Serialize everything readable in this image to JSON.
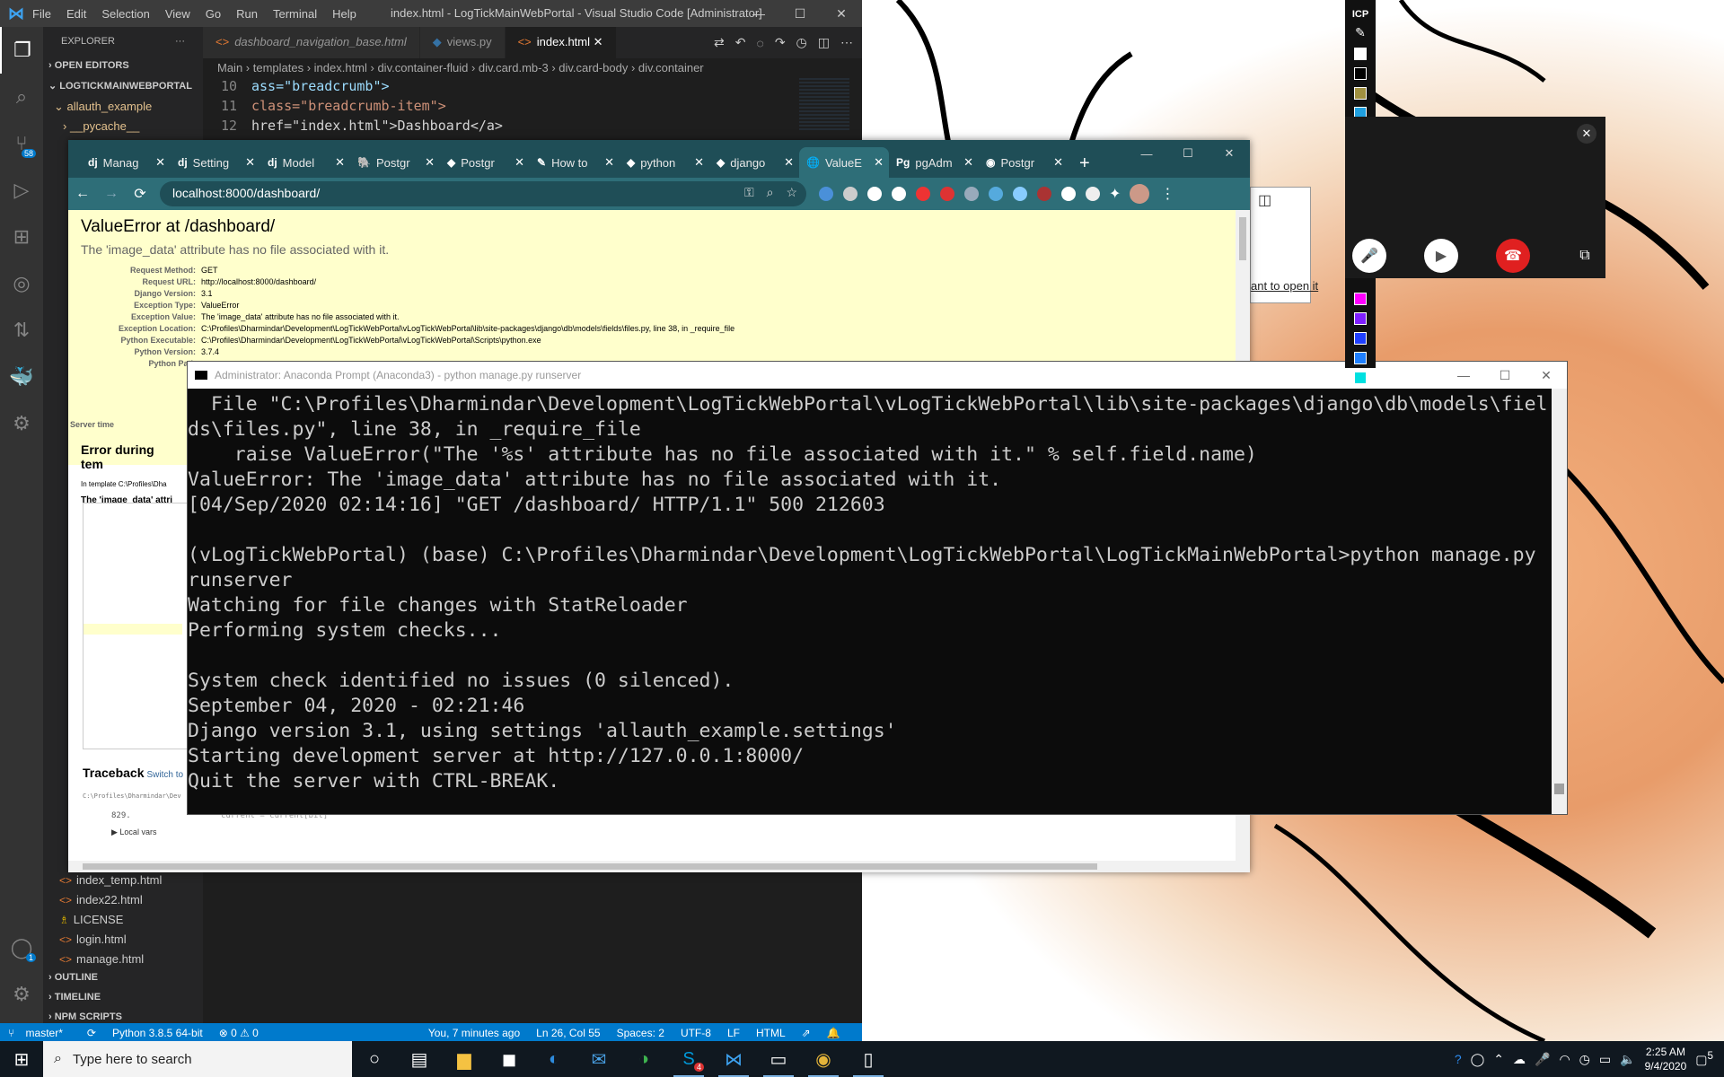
{
  "vscode": {
    "logo": "⋈",
    "menu": [
      "File",
      "Edit",
      "Selection",
      "View",
      "Go",
      "Run",
      "Terminal",
      "Help"
    ],
    "title": "index.html - LogTickMainWebPortal - Visual Studio Code [Administrator]",
    "explorer_label": "EXPLORER",
    "explorer_more": "···",
    "open_editors": "OPEN EDITORS",
    "project": "LOGTICKMAINWEBPORTAL",
    "tree_top": [
      "allauth_example",
      "__pycache__"
    ],
    "tree_bottom": [
      "index_temp.html",
      "index22.html",
      "LICENSE",
      "login.html",
      "manage.html"
    ],
    "sections": [
      "OUTLINE",
      "TIMELINE",
      "NPM SCRIPTS"
    ],
    "tabs": [
      "dashboard_navigation_base.html",
      "views.py",
      "index.html"
    ],
    "breadcrumbs": "Main › templates › index.html › div.container-fluid › div.card.mb-3 › div.card-body › div.container",
    "code": [
      {
        "ln": "10",
        "text": "ass=\"breadcrumb\">"
      },
      {
        "ln": "11",
        "text": "class=\"breadcrumb-item\">"
      },
      {
        "ln": "12",
        "text": " href=\"index.html\">Dashboard</a>"
      }
    ],
    "source_control_badge": "58",
    "accounts_badge": "1",
    "status": {
      "branch": "master*",
      "python": "Python 3.8.5 64-bit",
      "problems": "⊗ 0 ⚠ 0",
      "blame": "You, 7 minutes ago",
      "cursor": "Ln 26, Col 55",
      "spaces": "Spaces: 2",
      "encoding": "UTF-8",
      "eol": "LF",
      "language": "HTML"
    }
  },
  "chrome": {
    "tabs": [
      {
        "fav": "dj",
        "label": "Manag"
      },
      {
        "fav": "dj",
        "label": "Setting"
      },
      {
        "fav": "dj",
        "label": "Model"
      },
      {
        "fav": "🐘",
        "label": "Postgr"
      },
      {
        "fav": "◆",
        "label": "Postgr"
      },
      {
        "fav": "✎",
        "label": "How to"
      },
      {
        "fav": "◆",
        "label": "python"
      },
      {
        "fav": "◆",
        "label": "django"
      },
      {
        "fav": "🌐",
        "label": "ValueE"
      },
      {
        "fav": "Pg",
        "label": "pgAdm"
      },
      {
        "fav": "◉",
        "label": "Postgr"
      }
    ],
    "active_tab": 8,
    "url": "localhost:8000/dashboard/",
    "extension_colors": [
      "#4a90d9",
      "#cccccc",
      "#ffffff",
      "#ffffff",
      "#e33",
      "#d33",
      "#9ab",
      "#5ad",
      "#8cf",
      "#a33",
      "#fff",
      "#eee"
    ]
  },
  "django": {
    "title": "ValueError at /dashboard/",
    "subtitle": "The 'image_data' attribute has no file associated with it.",
    "meta": [
      {
        "k": "Request Method:",
        "v": "GET"
      },
      {
        "k": "Request URL:",
        "v": "http://localhost:8000/dashboard/"
      },
      {
        "k": "Django Version:",
        "v": "3.1"
      },
      {
        "k": "Exception Type:",
        "v": "ValueError"
      },
      {
        "k": "Exception Value:",
        "v": "The 'image_data' attribute has no file associated with it."
      },
      {
        "k": "Exception Location:",
        "v": "C:\\Profiles\\Dharmindar\\Development\\LogTickWebPortal\\vLogTickWebPortal\\lib\\site-packages\\django\\db\\models\\fields\\files.py, line 38, in _require_file"
      },
      {
        "k": "Python Executable:",
        "v": "C:\\Profiles\\Dharmindar\\Development\\LogTickWebPortal\\vLogTickWebPortal\\Scripts\\python.exe"
      },
      {
        "k": "Python Version:",
        "v": "3.7.4"
      },
      {
        "k": "Python Path",
        "v": ""
      }
    ],
    "server_time": "Server time",
    "template_error_title": "Error during tem",
    "in_template": "In template C:\\Profiles\\Dha",
    "template_error_msg": "The 'image_data' attri",
    "traceback_title": "Traceback",
    "traceback_switch": "Switch to",
    "tb_file": "C:\\Profiles\\Dharmindar\\Dev",
    "tb_line": "829.",
    "tb_code": "current = current[bit]",
    "local_vars": "▶ Local vars"
  },
  "hidden_window": {
    "link": "ant to open it"
  },
  "terminal": {
    "title": "Administrator: Anaconda Prompt (Anaconda3) - python  manage.py runserver",
    "lines": [
      "  File \"C:\\Profiles\\Dharmindar\\Development\\LogTickWebPortal\\vLogTickWebPortal\\lib\\site-packages\\django\\db\\models\\fiel",
      "ds\\files.py\", line 38, in _require_file",
      "    raise ValueError(\"The '%s' attribute has no file associated with it.\" % self.field.name)",
      "ValueError: The 'image_data' attribute has no file associated with it.",
      "[04/Sep/2020 02:14:16] \"GET /dashboard/ HTTP/1.1\" 500 212603",
      "",
      "(vLogTickWebPortal) (base) C:\\Profiles\\Dharmindar\\Development\\LogTickWebPortal\\LogTickMainWebPortal>python manage.py",
      "runserver",
      "Watching for file changes with StatReloader",
      "Performing system checks...",
      "",
      "System check identified no issues (0 silenced).",
      "September 04, 2020 - 02:21:46",
      "Django version 3.1, using settings 'allauth_example.settings'",
      "Starting development server at http://127.0.0.1:8000/",
      "Quit the server with CTRL-BREAK."
    ]
  },
  "annotation": {
    "label": "ICP",
    "colors_top": [
      "#ffffff",
      "#000000",
      "#a09040",
      "#20a0e0"
    ],
    "colors_bottom": [
      "#ff00ff",
      "#8020ff",
      "#2040ff",
      "#2080ff",
      "#00e0e0"
    ]
  },
  "call": {
    "close": "✕"
  },
  "taskbar": {
    "search_placeholder": "Type here to search",
    "time": "2:25 AM",
    "date": "9/4/2020",
    "notification_count": "5",
    "skype_badge": "4"
  }
}
